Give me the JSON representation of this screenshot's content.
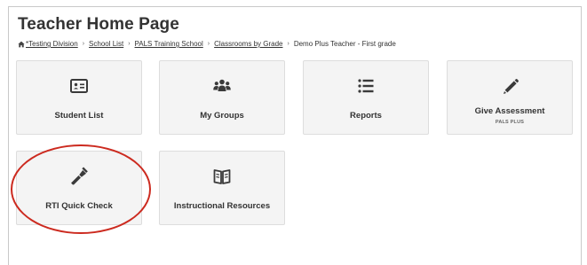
{
  "header": {
    "title": "Teacher Home Page"
  },
  "breadcrumb": {
    "home_icon": "home-icon",
    "items": [
      "*Testing Division",
      "School List",
      "PALS Training School",
      "Classrooms by Grade",
      "Demo Plus Teacher - First grade"
    ],
    "separator": "›"
  },
  "tiles": [
    {
      "label": "Student List",
      "icon": "id-card-icon"
    },
    {
      "label": "My Groups",
      "icon": "users-icon"
    },
    {
      "label": "Reports",
      "icon": "list-icon"
    },
    {
      "label": "Give Assessment",
      "sublabel": "PALS PLUS",
      "icon": "pencil-icon"
    },
    {
      "label": "RTI Quick Check",
      "icon": "flashlight-icon"
    },
    {
      "label": "Instructional Resources",
      "icon": "book-icon"
    }
  ],
  "colors": {
    "tile_background": "#f4f4f4",
    "icon": "#3a3a3a",
    "annotation_circle": "#cc2a1f"
  }
}
